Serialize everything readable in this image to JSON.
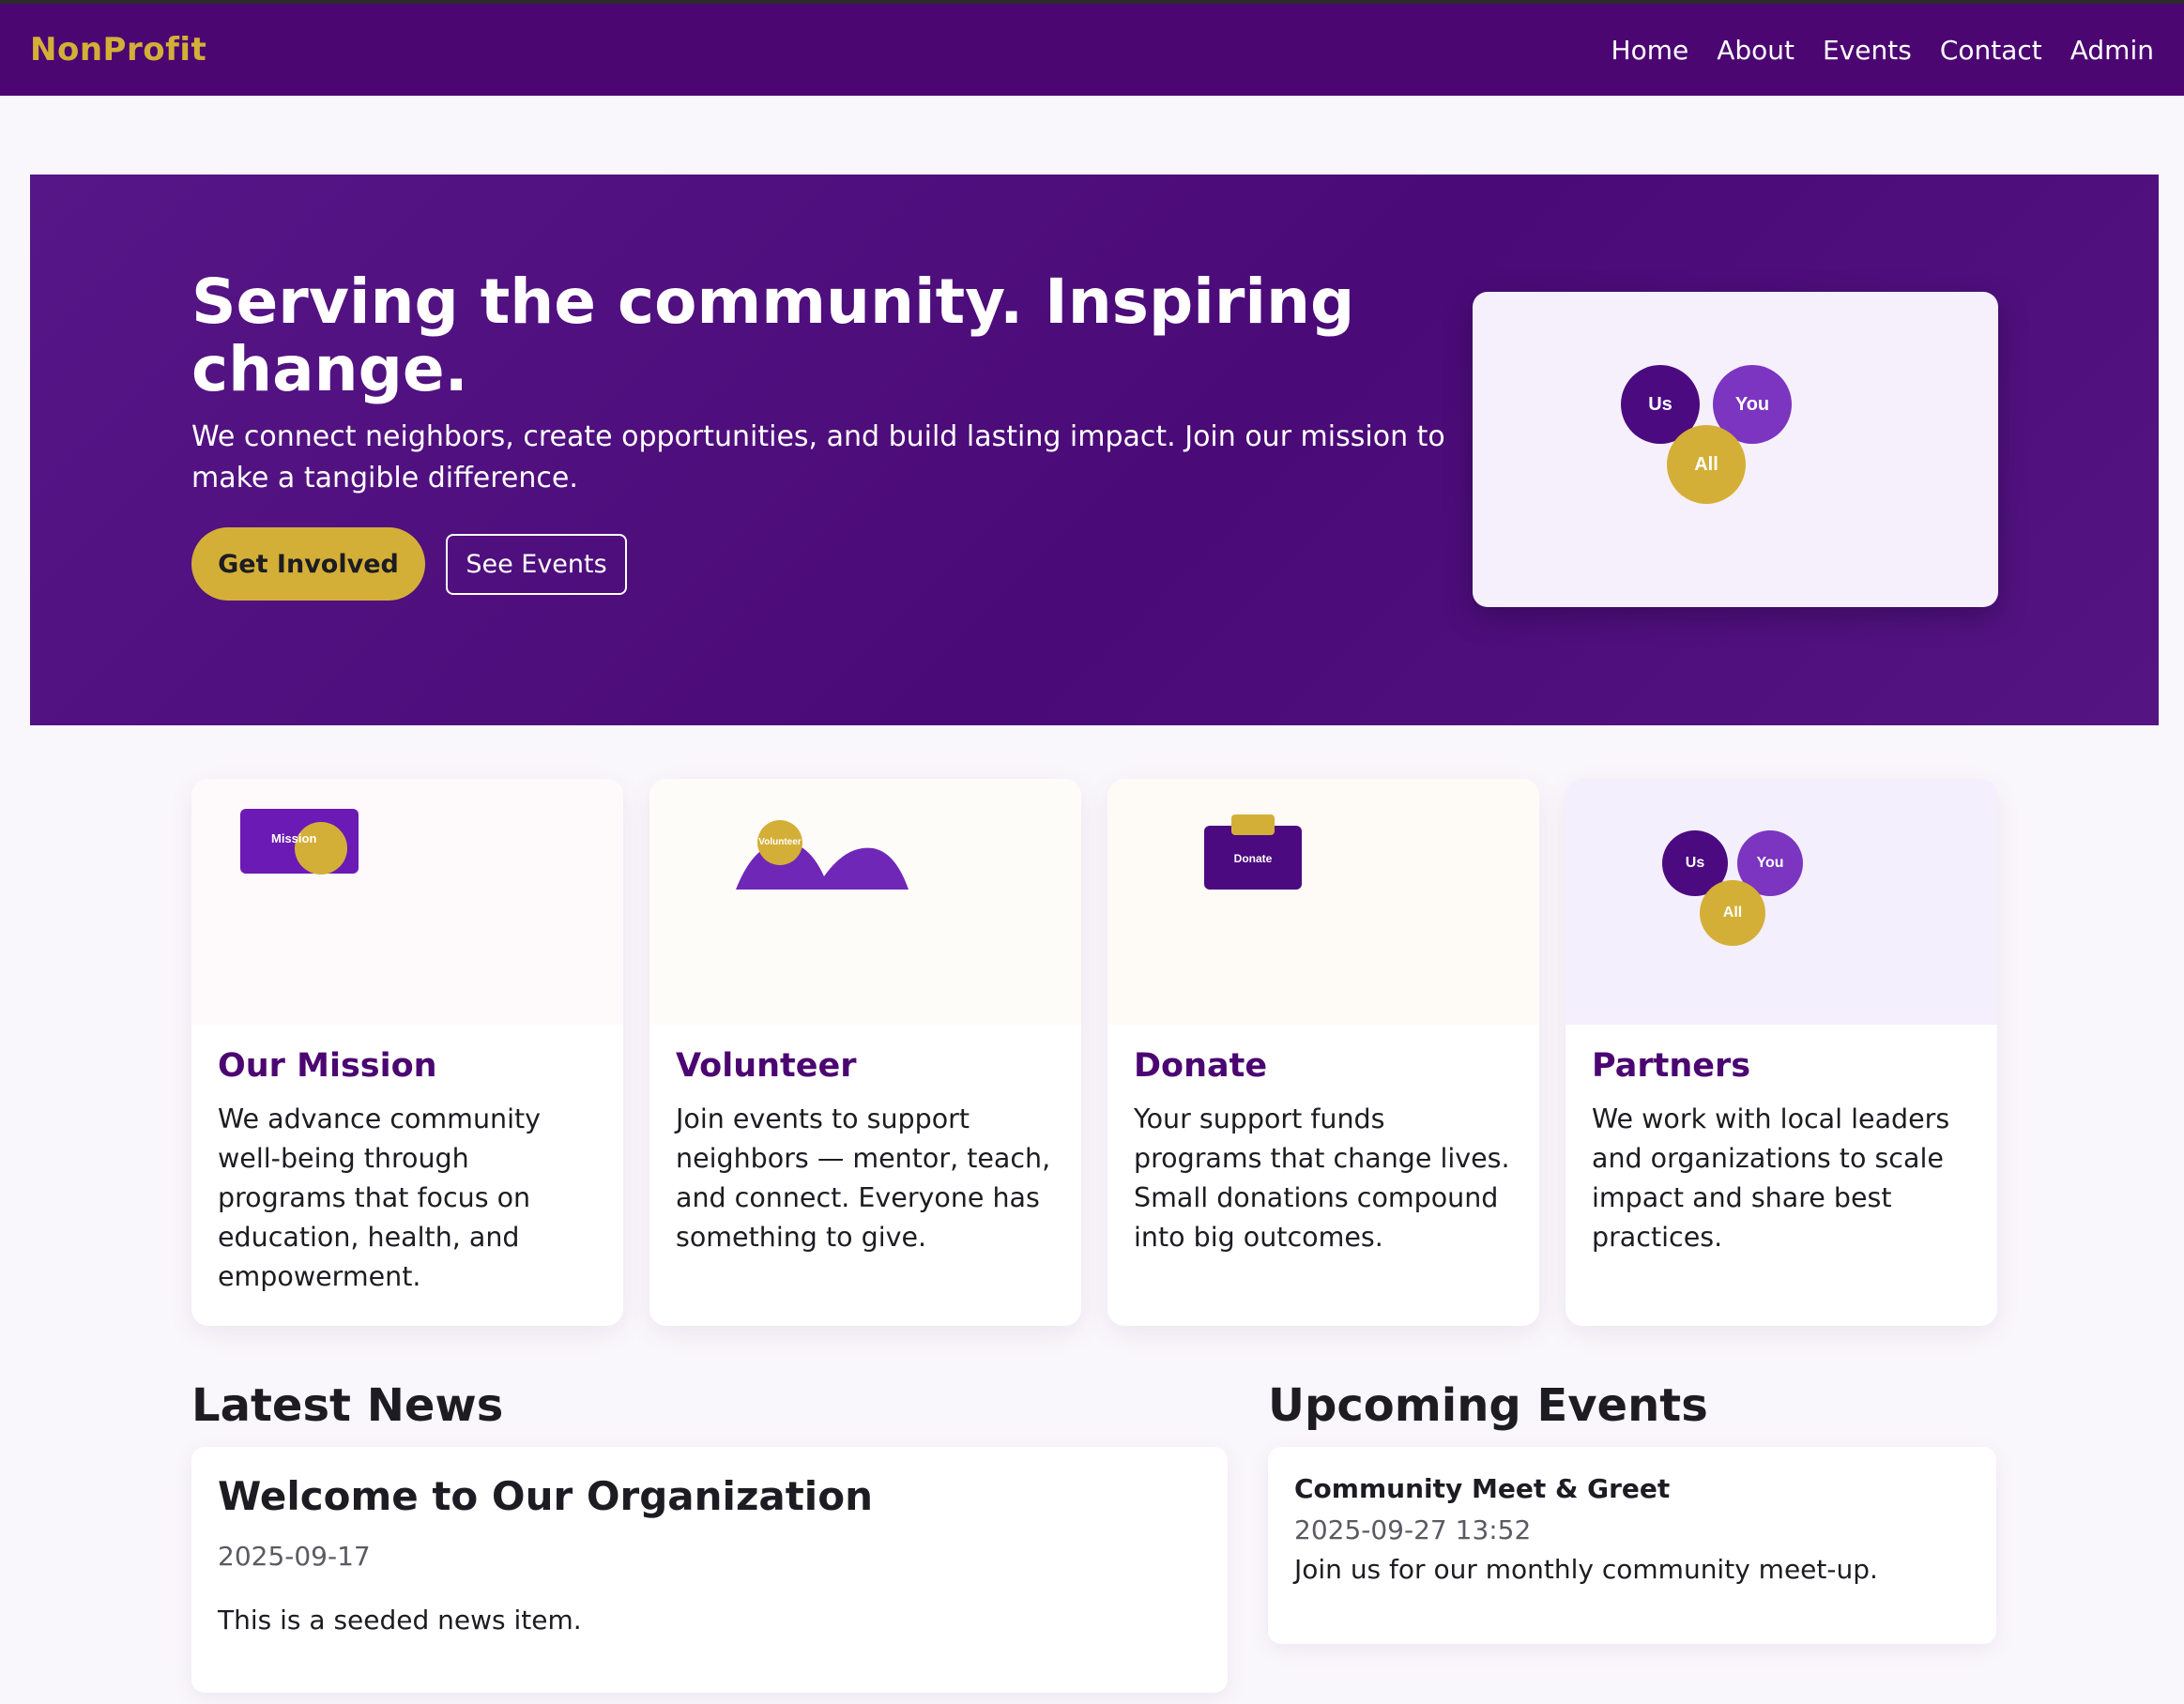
{
  "nav": {
    "brand": "NonProfit",
    "links": [
      "Home",
      "About",
      "Events",
      "Contact",
      "Admin"
    ]
  },
  "hero": {
    "title": "Serving the community. Inspiring change.",
    "subtitle": "We connect neighbors, create opportunities, and build lasting impact. Join our mission to make a tangible difference.",
    "primary_button": "Get Involved",
    "secondary_button": "See Events",
    "circles": [
      "Us",
      "You",
      "All"
    ]
  },
  "cards": [
    {
      "title": "Our Mission",
      "text": "We advance community well-being through programs that focus on education, health, and empowerment.",
      "art_label": "Mission"
    },
    {
      "title": "Volunteer",
      "text": "Join events to support neighbors — mentor, teach, and connect. Everyone has something to give.",
      "art_label": "Volunteer"
    },
    {
      "title": "Donate",
      "text": "Your support funds programs that change lives. Small donations compound into big outcomes.",
      "art_label": "Donate"
    },
    {
      "title": "Partners",
      "text": "We work with local leaders and organizations to scale impact and share best practices.",
      "art_circles": [
        "Us",
        "You",
        "All"
      ]
    }
  ],
  "news": {
    "heading": "Latest News",
    "items": [
      {
        "title": "Welcome to Our Organization",
        "date": "2025-09-17",
        "body": "This is a seeded news item."
      }
    ]
  },
  "events": {
    "heading": "Upcoming Events",
    "items": [
      {
        "title": "Community Meet & Greet",
        "datetime": "2025-09-27 13:52",
        "description": "Join us for our monthly community meet-up."
      }
    ]
  },
  "colors": {
    "brand_purple": "#4b0672",
    "accent_gold": "#d4af37",
    "light_purple": "#7b35c0"
  }
}
